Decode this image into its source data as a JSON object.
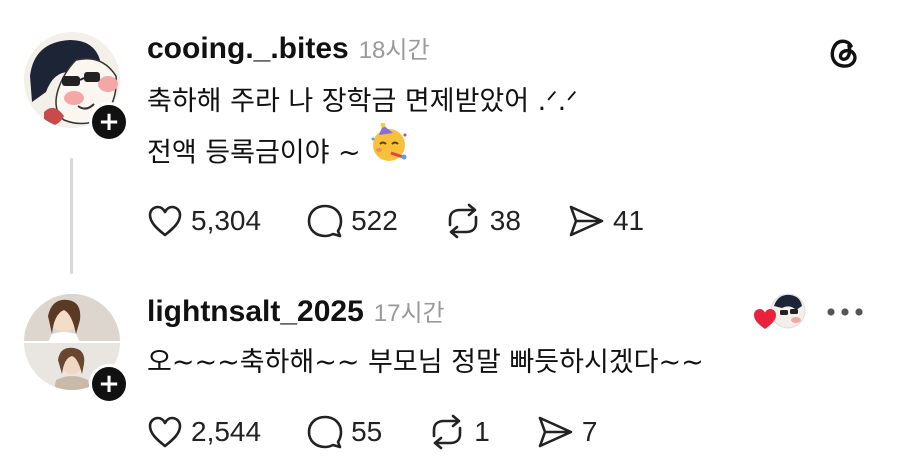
{
  "posts": [
    {
      "username": "cooing._.bites",
      "time": "18시간",
      "lines": [
        "축하해 주라 나 장학금 면제받았어 .ᐟ.ᐟ",
        "전액 등록금이야 ~"
      ],
      "emoji": "partying-face-emoji",
      "likes": "5,304",
      "comments": "522",
      "reposts": "38",
      "shares": "41"
    },
    {
      "username": "lightnsalt_2025",
      "time": "17시간",
      "lines": [
        "오~~~축하해~~ 부모님 정말 빠듯하시겠다~~"
      ],
      "likes": "2,544",
      "comments": "55",
      "reposts": "1",
      "shares": "7"
    }
  ],
  "icons": {
    "app_logo": "threads-logo-icon",
    "like": "heart-icon",
    "comment": "comment-bubble-icon",
    "repost": "repost-icon",
    "share": "send-icon",
    "liked_by_author": "heart-avatar-icon",
    "more": "more-options-icon"
  },
  "colors": {
    "liked_heart": "#e8223c",
    "time": "#9a9a9a",
    "thread_line": "#d8d8d8"
  }
}
